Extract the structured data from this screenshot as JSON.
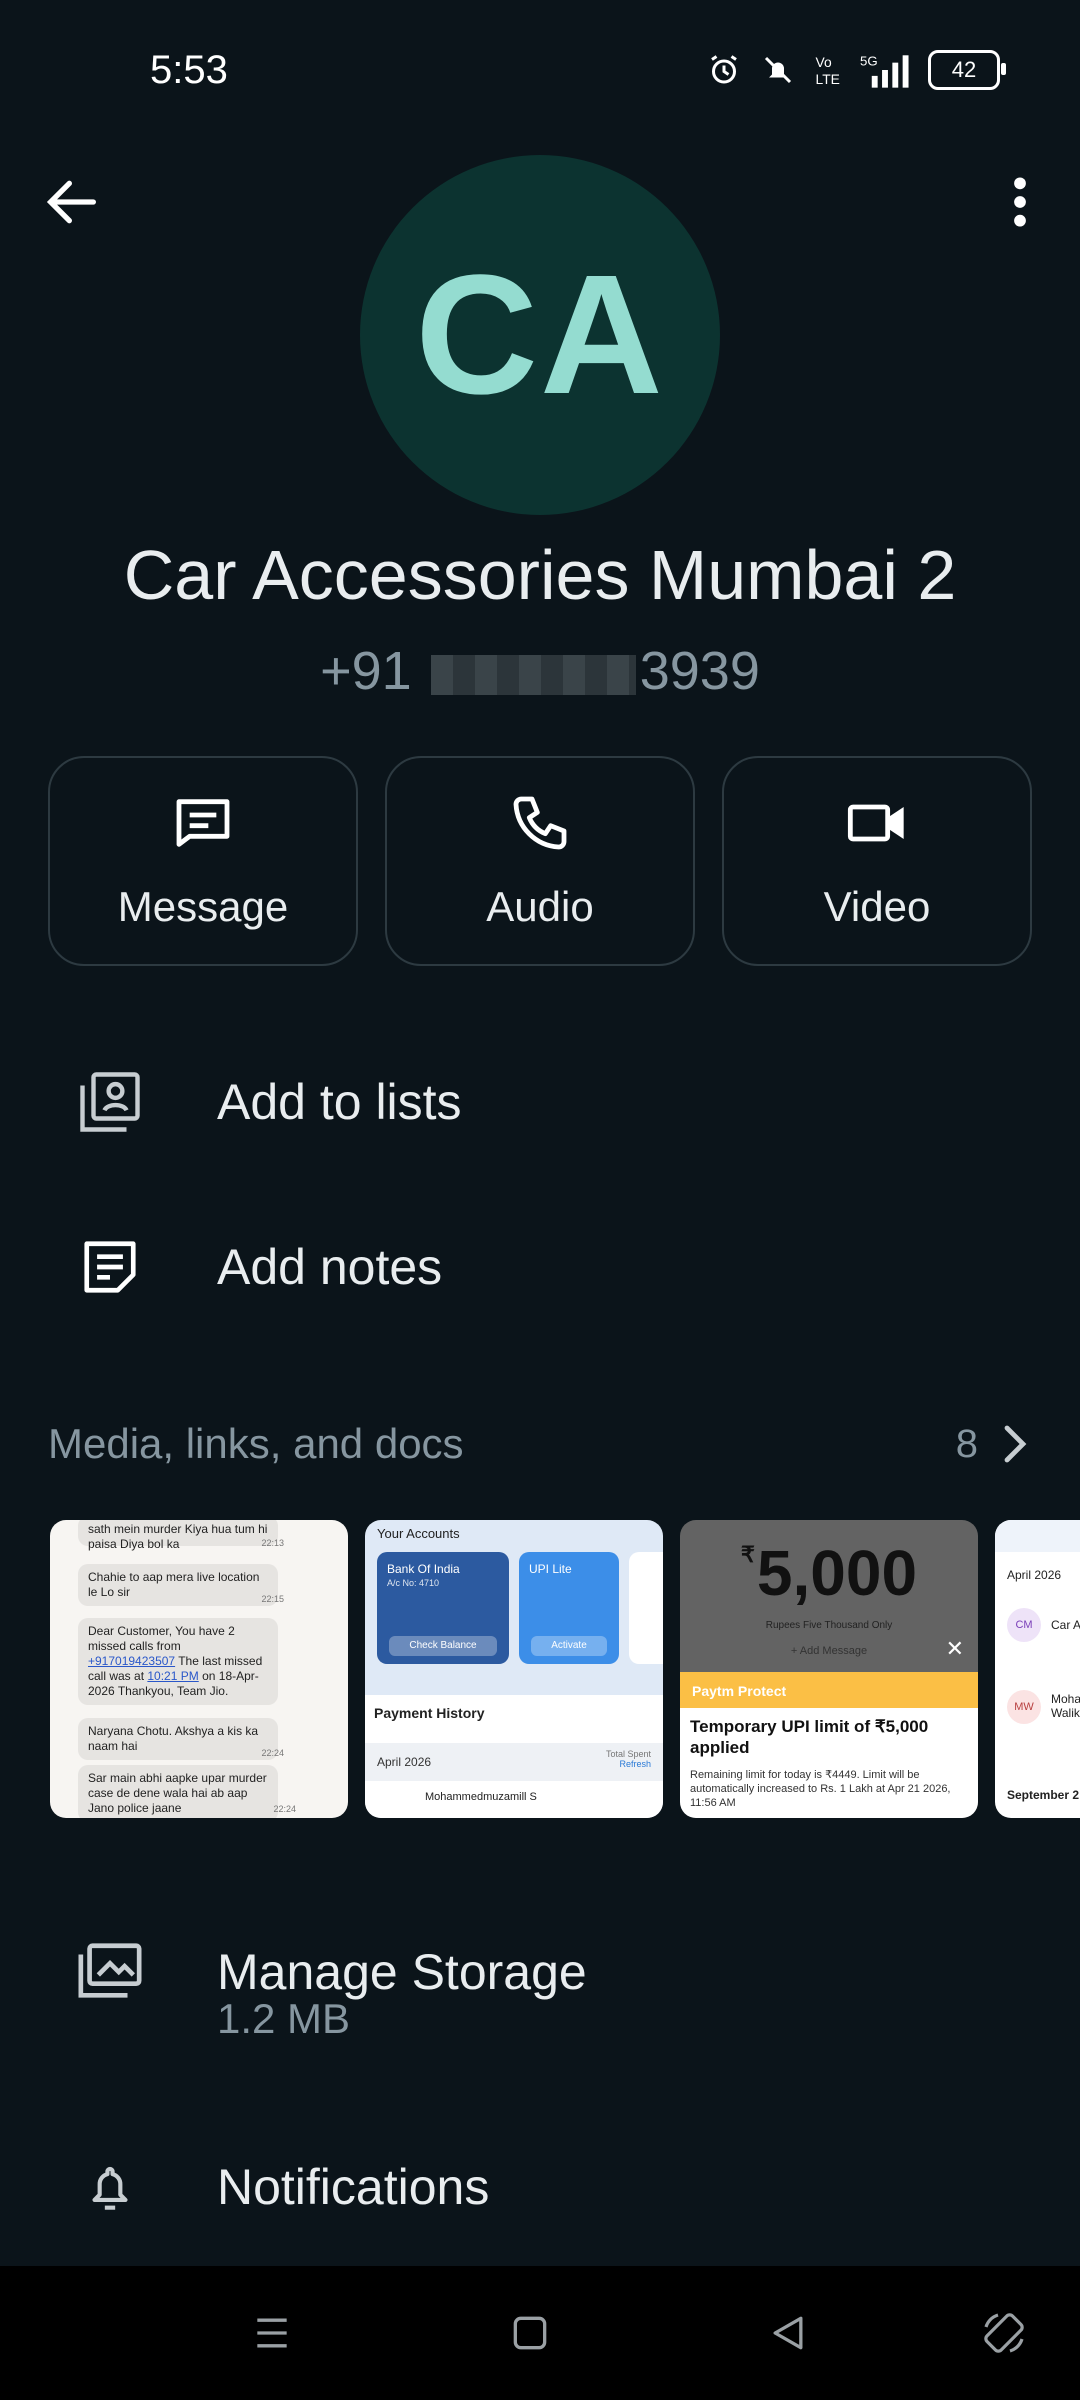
{
  "status_bar": {
    "time": "5:53",
    "battery": "42",
    "network": "5G"
  },
  "contact": {
    "initials": "CA",
    "name": "Car Accessories Mumbai 2",
    "phone_prefix": "+91",
    "phone_suffix": "3939"
  },
  "actions": [
    {
      "label": "Message",
      "icon": "message-icon"
    },
    {
      "label": "Audio",
      "icon": "phone-icon"
    },
    {
      "label": "Video",
      "icon": "video-icon"
    }
  ],
  "menu": {
    "add_to_lists": "Add to lists",
    "add_notes": "Add notes",
    "manage_storage": "Manage Storage",
    "storage_size": "1.2 MB",
    "notifications": "Notifications"
  },
  "media": {
    "title": "Media, links, and docs",
    "count": "8",
    "thumb1": {
      "msg1": "sath mein murder Kiya hua tum hi paisa Diya bol ka",
      "ts1": "22:13",
      "msg2": "Chahie to aap mera live location le Lo sir",
      "ts2": "22:15",
      "msg3a": "Dear Customer, You have 2 missed calls from",
      "msg3link": "+917019423507",
      "msg3b": "The last missed call was at",
      "msg3time": "10:21 PM",
      "msg3c": "on 18-Apr-2026 Thankyou, Team Jio.",
      "msg4": "Naryana Chotu. Akshya a kis ka naam hai",
      "ts4": "22:24",
      "msg5": "Sar main abhi aapke upar murder case de dene wala hai ab aap Jano police jaane",
      "ts5": "22:24"
    },
    "thumb2": {
      "header": "Your Accounts",
      "bank": "Bank Of India",
      "acno": "A/c No: 4710",
      "check": "Check Balance",
      "upi": "UPI Lite",
      "activate": "Activate",
      "payment_history": "Payment History",
      "month": "April 2026",
      "total": "Total Spent",
      "refresh": "Refresh",
      "payee": "Mohammedmuzamill S"
    },
    "thumb3": {
      "amount": "5,000",
      "rs": "₹",
      "words": "Rupees Five Thousand Only",
      "add_msg": "+ Add Message",
      "brand": "Paytm Protect",
      "title": "Temporary UPI limit of ₹5,000 applied",
      "sub": "Remaining limit for today is ₹4449. Limit will be automatically increased to Rs. 1 Lakh at Apr 21 2026, 11:56 AM"
    },
    "thumb4": {
      "month": "April 2026",
      "cm": "CM",
      "name1": "Car A",
      "mw": "MW",
      "name2": "Moha Walik",
      "sept": "September 2"
    }
  },
  "colors": {
    "background": "#0b141a",
    "avatar_bg": "#0c3330",
    "avatar_text": "#94dcd0",
    "secondary_text": "#8696a0"
  }
}
